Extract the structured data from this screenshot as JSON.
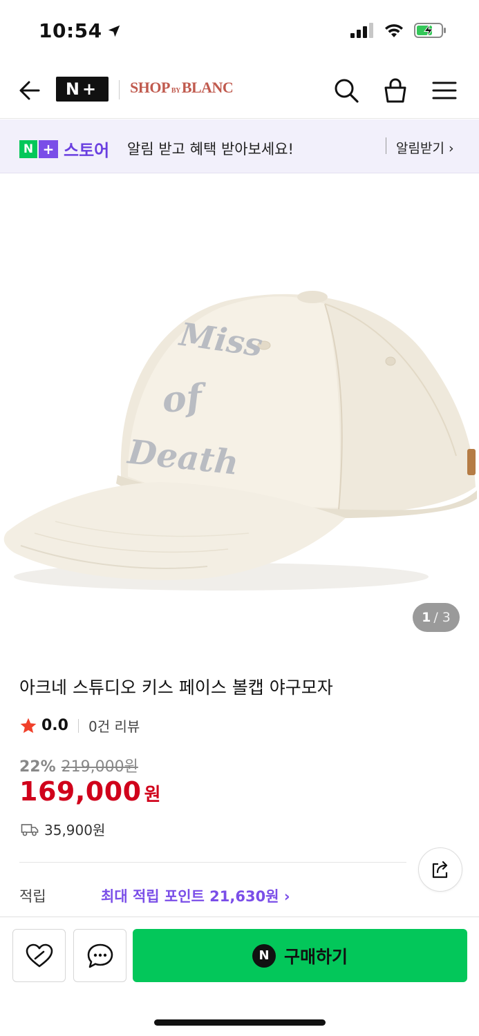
{
  "status_bar": {
    "time": "10:54"
  },
  "header": {
    "logo_text": "N+",
    "shop_logo_left": "SHOP",
    "shop_logo_by": "BY",
    "shop_logo_right": "BLANC"
  },
  "banner": {
    "store_label": "스토어",
    "text": "알림 받고 혜택 받아보세요!",
    "link_label": "알림받기 ›"
  },
  "image_counter": {
    "current": "1",
    "total": "/ 3"
  },
  "product": {
    "title": "아크네 스튜디오 키스 페이스 볼캡 야구모자",
    "rating": "0.0",
    "review_count": "0건 리뷰",
    "discount": "22%",
    "original_price": "219,000원",
    "sale_price": "169,000",
    "currency": "원",
    "shipping_fee": "35,900원",
    "cap_embroidery": [
      "Miss",
      "of",
      "Death"
    ]
  },
  "points": {
    "label": "적립",
    "link": "최대 적립 포인트 21,630원 ›"
  },
  "bottom_bar": {
    "buy_icon_letter": "N",
    "buy_label": "구매하기"
  },
  "colors": {
    "naver_green": "#03c75a",
    "plus_purple": "#7a4ee8",
    "price_red": "#d0021b",
    "banner_bg": "#f2f0fb"
  },
  "icons": [
    "location-arrow-icon",
    "signal-icon",
    "wifi-icon",
    "battery-charging-icon",
    "back-arrow-icon",
    "search-icon",
    "shopping-bag-icon",
    "menu-icon",
    "star-icon",
    "delivery-truck-icon",
    "share-icon",
    "heart-icon",
    "chat-bubble-icon"
  ]
}
